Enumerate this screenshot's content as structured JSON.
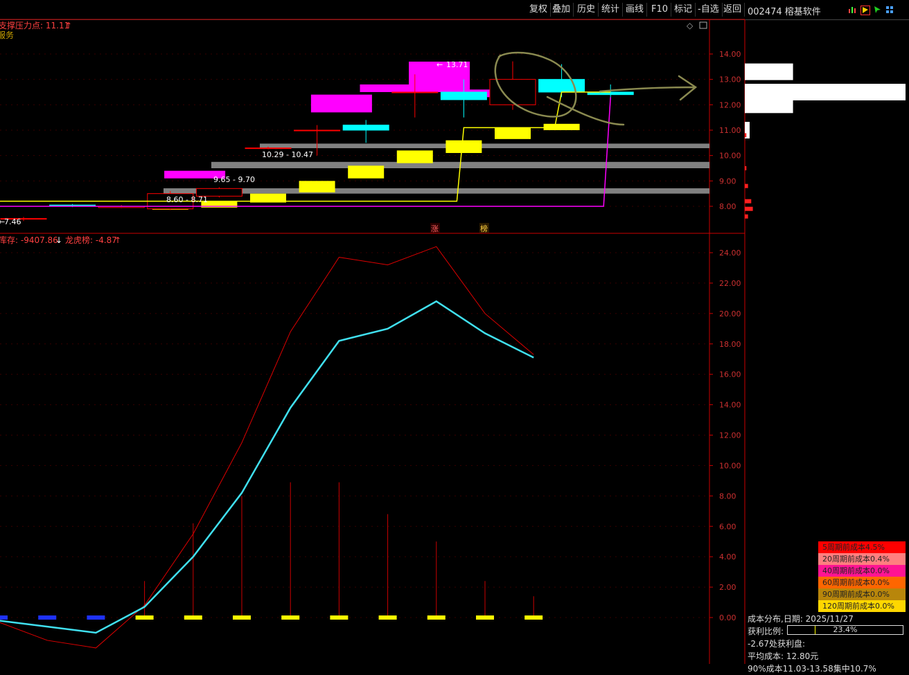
{
  "toolbar": {
    "buttons": [
      "复权",
      "叠加",
      "历史",
      "统计",
      "画线",
      "F10",
      "标记",
      "-自选",
      "返回"
    ],
    "stock_title": "002474 榕基软件"
  },
  "main_panel": {
    "indicator_label": "支撑压力点: 11.11",
    "sub_label": "服务",
    "range_labels": [
      "10.29 - 10.47",
      "9.65 - 9.70",
      "8.60 - 8.71",
      "7.46",
      "13.71"
    ],
    "markers": [
      "涨",
      "榜"
    ]
  },
  "lower_panel": {
    "label_a": "库存: -9407.86",
    "label_b": "龙虎榜: -4.87"
  },
  "chart_data": [
    {
      "type": "candlestick",
      "title": "",
      "ylim": [
        7.3,
        14.6
      ],
      "y_ticks": [
        "14.00",
        "13.00",
        "12.00",
        "11.00",
        "10.00",
        "9.00",
        "8.00"
      ],
      "candles": [
        {
          "open": 7.5,
          "close": 7.52,
          "high": 7.58,
          "low": 7.42
        },
        {
          "open": 8.05,
          "close": 8.02,
          "high": 8.09,
          "low": 7.97
        },
        {
          "open": 7.95,
          "close": 8.0,
          "high": 8.05,
          "low": 7.93
        },
        {
          "open": 7.9,
          "close": 8.5,
          "high": 8.6,
          "low": 7.85
        },
        {
          "open": 8.4,
          "close": 8.7,
          "high": 8.75,
          "low": 8.35
        },
        {
          "open": 10.3,
          "close": 10.3,
          "high": 10.35,
          "low": 10.25
        },
        {
          "open": 11.0,
          "close": 11.0,
          "high": 11.2,
          "low": 10.0
        },
        {
          "open": 11.2,
          "close": 11.0,
          "high": 11.4,
          "low": 10.5
        },
        {
          "open": 12.5,
          "close": 12.5,
          "high": 13.2,
          "low": 11.5
        },
        {
          "open": 12.5,
          "close": 12.2,
          "high": 13.0,
          "low": 11.5
        },
        {
          "open": 12.0,
          "close": 13.0,
          "high": 13.71,
          "low": 11.8
        },
        {
          "open": 13.0,
          "close": 12.5,
          "high": 13.6,
          "low": 12.3
        },
        {
          "open": 12.5,
          "close": 12.4,
          "high": 12.8,
          "low": 12.2
        }
      ],
      "support_bands": [
        {
          "low": 10.29,
          "high": 10.47
        },
        {
          "low": 9.5,
          "high": 9.75
        },
        {
          "low": 8.5,
          "high": 8.71
        }
      ],
      "yellow_boxes": [
        {
          "low": 7.9,
          "high": 7.95
        },
        {
          "low": 7.95,
          "high": 8.2
        },
        {
          "low": 8.15,
          "high": 8.5
        },
        {
          "low": 8.55,
          "high": 9.0
        },
        {
          "low": 9.1,
          "high": 9.6
        },
        {
          "low": 9.7,
          "high": 10.2
        },
        {
          "low": 10.1,
          "high": 10.6
        },
        {
          "low": 10.65,
          "high": 11.1
        },
        {
          "low": 11.0,
          "high": 11.25
        }
      ],
      "magenta_boxes": [
        {
          "low": 9.1,
          "high": 9.4
        },
        {
          "low": 11.7,
          "high": 12.4
        },
        {
          "low": 12.5,
          "high": 12.8
        },
        {
          "low": 12.5,
          "high": 13.7
        },
        {
          "low": 12.3,
          "high": 12.6
        }
      ],
      "yellow_line": [
        8.2,
        8.2,
        8.2,
        8.2,
        8.2,
        8.2,
        8.2,
        8.2,
        8.2,
        11.1,
        11.1,
        12.5,
        12.5
      ],
      "magenta_line": [
        8.0,
        8.0,
        8.0,
        8.0,
        8.0,
        8.0,
        8.0,
        8.0,
        8.0,
        8.0,
        8.0,
        8.0,
        12.3
      ]
    },
    {
      "type": "line",
      "title": "",
      "ylim": [
        -1.5,
        25.5
      ],
      "y_ticks": [
        "24.00",
        "22.00",
        "20.00",
        "18.00",
        "16.00",
        "14.00",
        "12.00",
        "10.00",
        "8.00",
        "6.00",
        "4.00",
        "2.00",
        "0.00"
      ],
      "series": [
        {
          "values": [
            -0.3,
            -1.5,
            -2.0,
            0.8,
            5.5,
            11.5,
            18.8,
            23.7,
            23.2,
            24.4,
            20.0,
            17.3
          ]
        },
        {
          "values": [
            -0.2,
            -0.6,
            -1.0,
            0.7,
            4.0,
            8.2,
            13.8,
            18.2,
            19.0,
            20.8,
            18.7,
            17.1
          ]
        }
      ],
      "spikes": [
        0,
        0,
        0,
        2.4,
        6.2,
        8.0,
        8.9,
        8.9,
        6.8,
        5.0,
        2.4,
        1.4
      ],
      "markers": [
        {
          "color": "#1e32ff"
        },
        {
          "color": "#1e32ff"
        },
        {
          "color": "#1e32ff"
        },
        {
          "color": "#ffff00"
        },
        {
          "color": "#ffff00"
        },
        {
          "color": "#ffff00"
        },
        {
          "color": "#ffff00"
        },
        {
          "color": "#ffff00"
        },
        {
          "color": "#ffff00"
        },
        {
          "color": "#ffff00"
        },
        {
          "color": "#ffff00"
        },
        {
          "color": "#ffff00"
        }
      ]
    },
    {
      "type": "bar",
      "title": "cost distribution",
      "orientation": "horizontal",
      "ylim": [
        7.3,
        14.6
      ],
      "white_bars": [
        {
          "price": 13.3,
          "value": 0.3
        },
        {
          "price": 12.5,
          "value": 1.0
        },
        {
          "price": 12.0,
          "value": 0.3
        },
        {
          "price": 11.0,
          "value": 0.03
        }
      ],
      "red_bars": [
        {
          "price": 10.8,
          "value": 0.01
        },
        {
          "price": 9.5,
          "value": 0.01
        },
        {
          "price": 8.8,
          "value": 0.02
        },
        {
          "price": 8.2,
          "value": 0.04
        },
        {
          "price": 7.9,
          "value": 0.05
        },
        {
          "price": 7.6,
          "value": 0.02
        }
      ]
    }
  ],
  "cost_panel": {
    "rows": [
      {
        "label": "5周期前成本4.5%",
        "color": "#ff0000"
      },
      {
        "label": "20周期前成本0.4%",
        "color": "#ff7f7f"
      },
      {
        "label": "40周期前成本0.0%",
        "color": "#ff1493"
      },
      {
        "label": "60周期前成本0.0%",
        "color": "#ff6600"
      },
      {
        "label": "90周期前成本0.0%",
        "color": "#b8860b"
      },
      {
        "label": "120周期前成本0.0%",
        "color": "#ffd700"
      }
    ],
    "date_line": "成本分布,日期: 2025/11/27",
    "profit_label": "获利比例:",
    "profit_value": "23.4%",
    "profit_fraction": 0.234,
    "profit_line": "-2.67处获利盘:",
    "avg_cost": "平均成本: 12.80元",
    "concentration": "90%成本11.03-13.58集中10.7%"
  },
  "colors": {
    "up": "#ff0000",
    "down": "#00ffff",
    "axis": "#cc0000",
    "yellow": "#ffff00",
    "magenta": "#ff00ff",
    "gray_band": "#808080",
    "cyan_line": "#40e0f0"
  }
}
